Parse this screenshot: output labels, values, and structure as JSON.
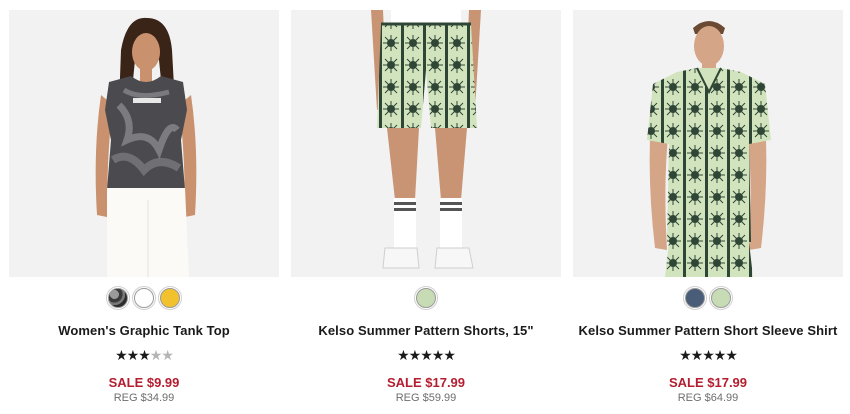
{
  "products": [
    {
      "name": "Women's Graphic Tank Top",
      "image_alt": "woman wearing tie-dye tank top",
      "swatches": [
        {
          "color_name": "tie-dye black",
          "hex": "#555555"
        },
        {
          "color_name": "white",
          "hex": "#ffffff"
        },
        {
          "color_name": "yellow",
          "hex": "#f2c12e"
        }
      ],
      "rating": 3,
      "rating_max": 5,
      "sale_price": "SALE $9.99",
      "regular_price": "REG $34.99"
    },
    {
      "name": "Kelso Summer Pattern Shorts, 15\"",
      "image_alt": "model wearing patterned shorts",
      "swatches": [
        {
          "color_name": "light green",
          "hex": "#c7dbb4"
        }
      ],
      "rating": 5,
      "rating_max": 5,
      "sale_price": "SALE $17.99",
      "regular_price": "REG $59.99"
    },
    {
      "name": "Kelso Summer Pattern Short Sleeve Shirt",
      "image_alt": "man wearing patterned short sleeve shirt",
      "swatches": [
        {
          "color_name": "navy",
          "hex": "#4a5d78"
        },
        {
          "color_name": "light green",
          "hex": "#c7dbb4"
        }
      ],
      "rating": 5,
      "rating_max": 5,
      "sale_price": "SALE $17.99",
      "regular_price": "REG $64.99"
    }
  ],
  "colors": {
    "sale": "#b41d2f",
    "regular": "#6e6e6e",
    "star_on": "#1a1a1a",
    "star_off": "#b5b5b5",
    "photo_bg": "#f2f2f2"
  }
}
